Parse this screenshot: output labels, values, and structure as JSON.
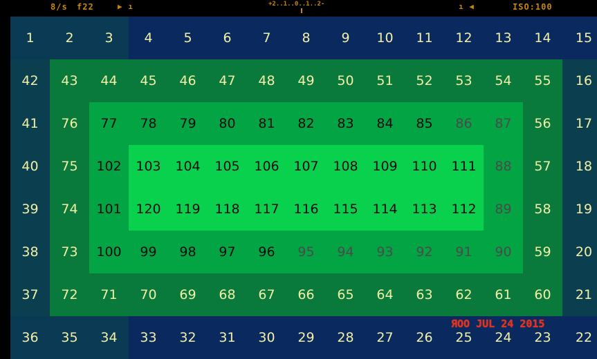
{
  "viewfinder": {
    "shutter": "8/s",
    "aperture": "f22",
    "play": "▶ ı",
    "exposure_meter": "+2..1..0..1..2-",
    "rewind": "ı ◀",
    "iso": "ISO:100"
  },
  "date_stamp": "ЯOO JUL 24 2015",
  "colors": {
    "ring0": "#0b2d63",
    "ring1": "#0a7a3c",
    "ring2": "#02a443",
    "ring3": "#09d14d",
    "ring4": "#0aeb50",
    "text_light": "#f2f0a6",
    "text_dark": "#0a0a0a",
    "text_gray": "#4b4b4b",
    "date_red": "#e8321e"
  },
  "grid": {
    "rows": [
      [
        1,
        2,
        3,
        4,
        5,
        6,
        7,
        8,
        9,
        10,
        11,
        12,
        13,
        14,
        15
      ],
      [
        42,
        43,
        44,
        45,
        46,
        47,
        48,
        49,
        50,
        51,
        52,
        53,
        54,
        55,
        16
      ],
      [
        41,
        76,
        77,
        78,
        79,
        80,
        81,
        82,
        83,
        84,
        85,
        86,
        87,
        56,
        17
      ],
      [
        40,
        75,
        102,
        103,
        104,
        105,
        106,
        107,
        108,
        109,
        110,
        111,
        88,
        57,
        18
      ],
      [
        39,
        74,
        101,
        120,
        119,
        118,
        117,
        116,
        115,
        114,
        113,
        112,
        89,
        58,
        19
      ],
      [
        38,
        73,
        100,
        99,
        98,
        97,
        96,
        95,
        94,
        93,
        92,
        91,
        90,
        59,
        20
      ],
      [
        37,
        72,
        71,
        70,
        69,
        68,
        67,
        66,
        65,
        64,
        63,
        62,
        61,
        60,
        21
      ],
      [
        36,
        35,
        34,
        33,
        32,
        31,
        30,
        29,
        28,
        27,
        26,
        25,
        24,
        23,
        22
      ]
    ]
  }
}
